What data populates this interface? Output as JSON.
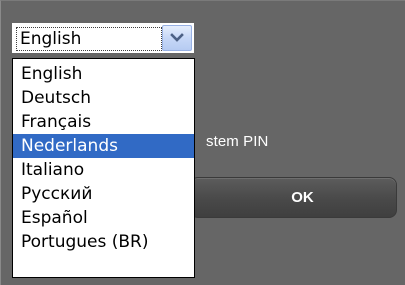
{
  "form": {
    "pin_label": "stem PIN",
    "ok_label": "OK"
  },
  "language_select": {
    "value": "English",
    "arrow_icon": "chevron-down-icon",
    "options": [
      "English",
      "Deutsch",
      "Français",
      "Nederlands",
      "Italiano",
      "Русский",
      "Español",
      "Portugues (BR)"
    ],
    "highlighted_index": 3
  },
  "colors": {
    "background": "#646464",
    "highlight": "#316ac5",
    "button_text": "#ffffff"
  }
}
